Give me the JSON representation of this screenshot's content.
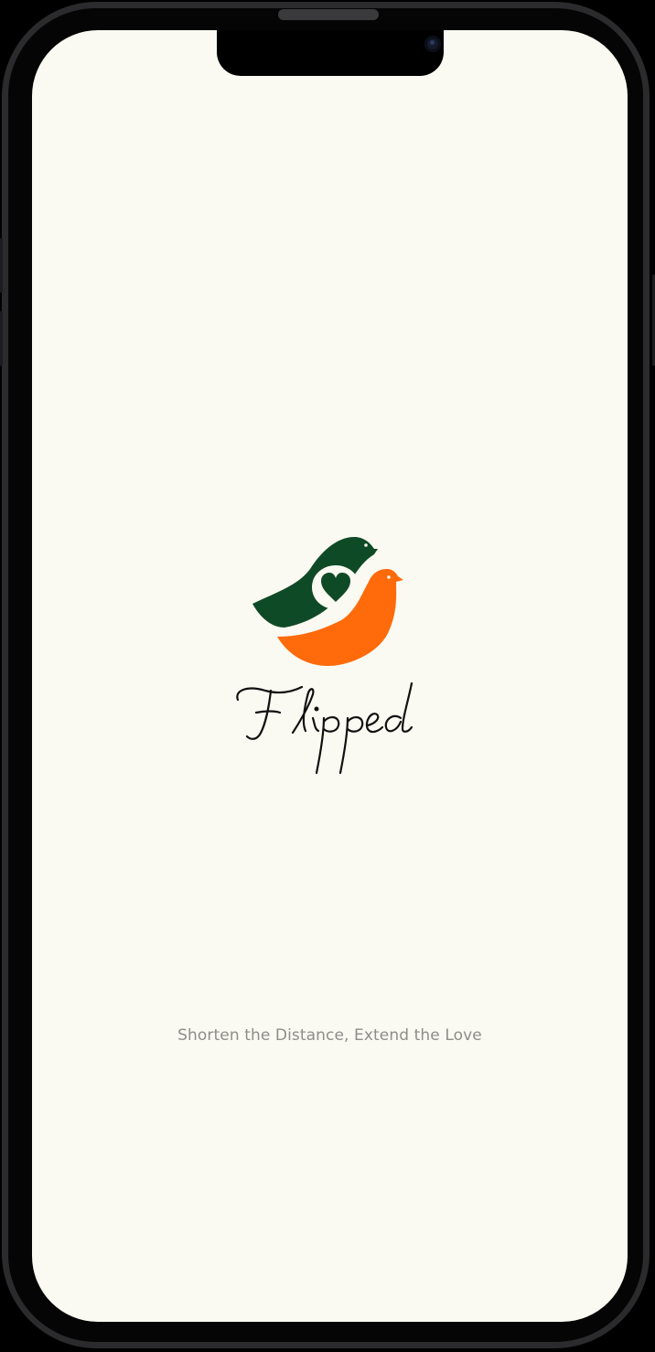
{
  "app": {
    "name": "Flipped",
    "tagline": "Shorten the Distance, Extend the Love"
  },
  "colors": {
    "screen_background": "#fbfaf2",
    "bird_back": "#0f4a27",
    "bird_front": "#ff6a0a",
    "heart": "#0f4a27",
    "bubble": "#fbfaf2",
    "wordmark": "#111111",
    "tagline": "#8d8d8a"
  },
  "icons": {
    "logo": "two-birds-heart-logo"
  }
}
